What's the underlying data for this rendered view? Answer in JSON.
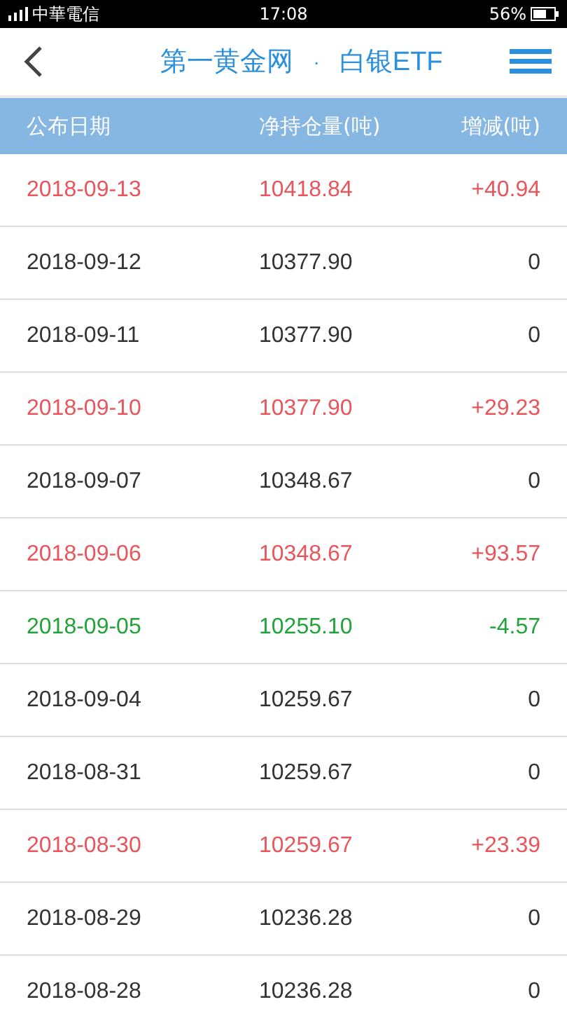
{
  "status_bar": {
    "carrier": "中華電信",
    "time": "17:08",
    "battery": "56%"
  },
  "nav": {
    "title": "第一黄金网",
    "separator": "·",
    "subtitle": "白银ETF"
  },
  "table": {
    "columns": [
      "公布日期",
      "净持仓量(吨)",
      "增减(吨)"
    ],
    "rows": [
      {
        "color": "#e8555a",
        "date": "2018-09-13",
        "holding": "10418.84",
        "change": "+40.94"
      },
      {
        "color": "#333333",
        "date": "2018-09-12",
        "holding": "10377.90",
        "change": "0"
      },
      {
        "color": "#333333",
        "date": "2018-09-11",
        "holding": "10377.90",
        "change": "0"
      },
      {
        "color": "#e8555a",
        "date": "2018-09-10",
        "holding": "10377.90",
        "change": "+29.23"
      },
      {
        "color": "#333333",
        "date": "2018-09-07",
        "holding": "10348.67",
        "change": "0"
      },
      {
        "color": "#e8555a",
        "date": "2018-09-06",
        "holding": "10348.67",
        "change": "+93.57"
      },
      {
        "color": "#22a33a",
        "date": "2018-09-05",
        "holding": "10255.10",
        "change": "-4.57"
      },
      {
        "color": "#333333",
        "date": "2018-09-04",
        "holding": "10259.67",
        "change": "0"
      },
      {
        "color": "#333333",
        "date": "2018-08-31",
        "holding": "10259.67",
        "change": "0"
      },
      {
        "color": "#e8555a",
        "date": "2018-08-30",
        "holding": "10259.67",
        "change": "+23.39"
      },
      {
        "color": "#333333",
        "date": "2018-08-29",
        "holding": "10236.28",
        "change": "0"
      },
      {
        "color": "#333333",
        "date": "2018-08-28",
        "holding": "10236.28",
        "change": "0"
      }
    ]
  }
}
